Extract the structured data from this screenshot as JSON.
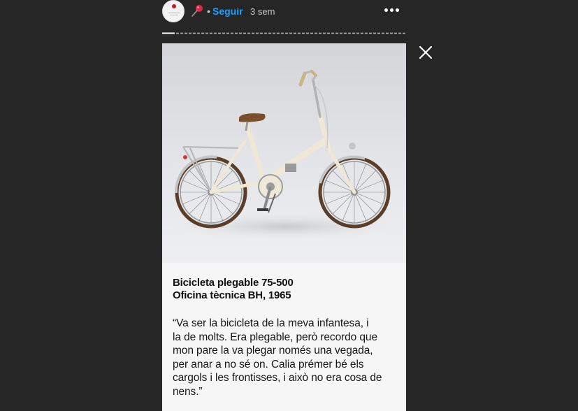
{
  "header": {
    "separator": "•",
    "follow_label": "Seguir",
    "timestamp": "3 sem",
    "pin_icon": "pin-icon",
    "more_icon": "more-options-icon"
  },
  "close_icon": "close-icon",
  "story": {
    "caption_title_lines": [
      "Bicicleta plegable 75-500",
      "Oficina tècnica BH, 1965"
    ],
    "quote_lines": [
      "“Va ser la bicicleta de la meva infantesa, i",
      "la de molts. Era plegable, però recordo que",
      "mon pare la va plegar només una vegada,",
      "per anar a no sé on. Calia prémer bé els",
      "cargols i les frontisses, i això no era cosa de",
      "nens.”"
    ]
  },
  "colors": {
    "background": "#262626",
    "accent": "#1aa0ff",
    "bike_frame": "#efe8d6",
    "saddle": "#7b4e2c"
  }
}
